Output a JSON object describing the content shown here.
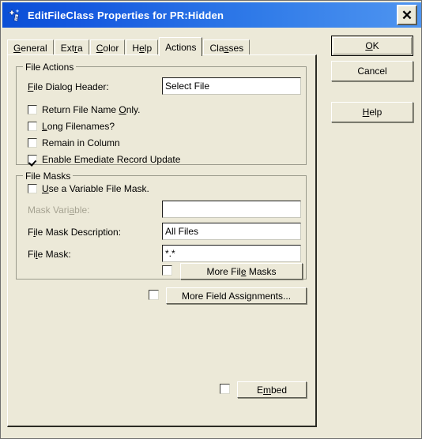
{
  "window": {
    "title": "EditFileClass Properties for PR:Hidden",
    "icon": "wizard-wand-icon",
    "close_label": "✕",
    "colors": {
      "titlebar_start": "#0b4fd6",
      "titlebar_end": "#4f95f0",
      "face": "#ece9d8",
      "field": "#ffffff",
      "disabled_text": "#a6a392"
    }
  },
  "tabs": [
    {
      "label": "General",
      "acc_index": 0,
      "selected": false
    },
    {
      "label": "Extra",
      "acc_index": 3,
      "selected": false
    },
    {
      "label": "Color",
      "acc_index": 0,
      "selected": false
    },
    {
      "label": "Help",
      "acc_index": 2,
      "selected": false
    },
    {
      "label": "Actions",
      "acc_index": -1,
      "selected": true
    },
    {
      "label": "Classes",
      "acc_index": 3,
      "selected": false
    }
  ],
  "file_actions": {
    "group_label": "File Actions",
    "dialog_header_label": "File Dialog Header:",
    "dialog_header_label_acc": 1,
    "dialog_header_value": "Select File",
    "checkboxes": [
      {
        "label": "Return File Name Only.",
        "acc_index": 16,
        "checked": false
      },
      {
        "label": "Long Filenames?",
        "acc_index": 0,
        "checked": false
      },
      {
        "label": "Remain in Column",
        "acc_index": -1,
        "checked": false
      },
      {
        "label": "Enable Emediate Record Update",
        "acc_index": -1,
        "checked": true
      }
    ]
  },
  "file_masks": {
    "group_label": "File Masks",
    "use_variable_mask": {
      "label": "Use a Variable File Mask.",
      "acc_index": 0,
      "checked": false
    },
    "mask_variable_label": "Mask Variable:",
    "mask_variable_label_acc": 9,
    "mask_variable_value": "",
    "mask_variable_disabled": true,
    "mask_description_label": "File Mask Description:",
    "mask_description_label_acc": 2,
    "mask_description_value": "All Files",
    "mask_label": "File Mask:",
    "mask_label_acc": 3,
    "mask_value": "*.*",
    "more_masks_button": "More File Masks",
    "more_masks_button_acc": 9,
    "more_masks_checked": false
  },
  "more_field_assignments": {
    "button_label": "More Field Assignments...",
    "checked": false
  },
  "embed": {
    "button_label": "Embed",
    "button_acc": 1,
    "checked": false
  },
  "side_buttons": [
    {
      "label": "OK",
      "acc_index": 0,
      "default": true
    },
    {
      "label": "Cancel",
      "acc_index": -1,
      "default": false
    },
    {
      "label": "Help",
      "acc_index": 0,
      "default": false
    }
  ]
}
